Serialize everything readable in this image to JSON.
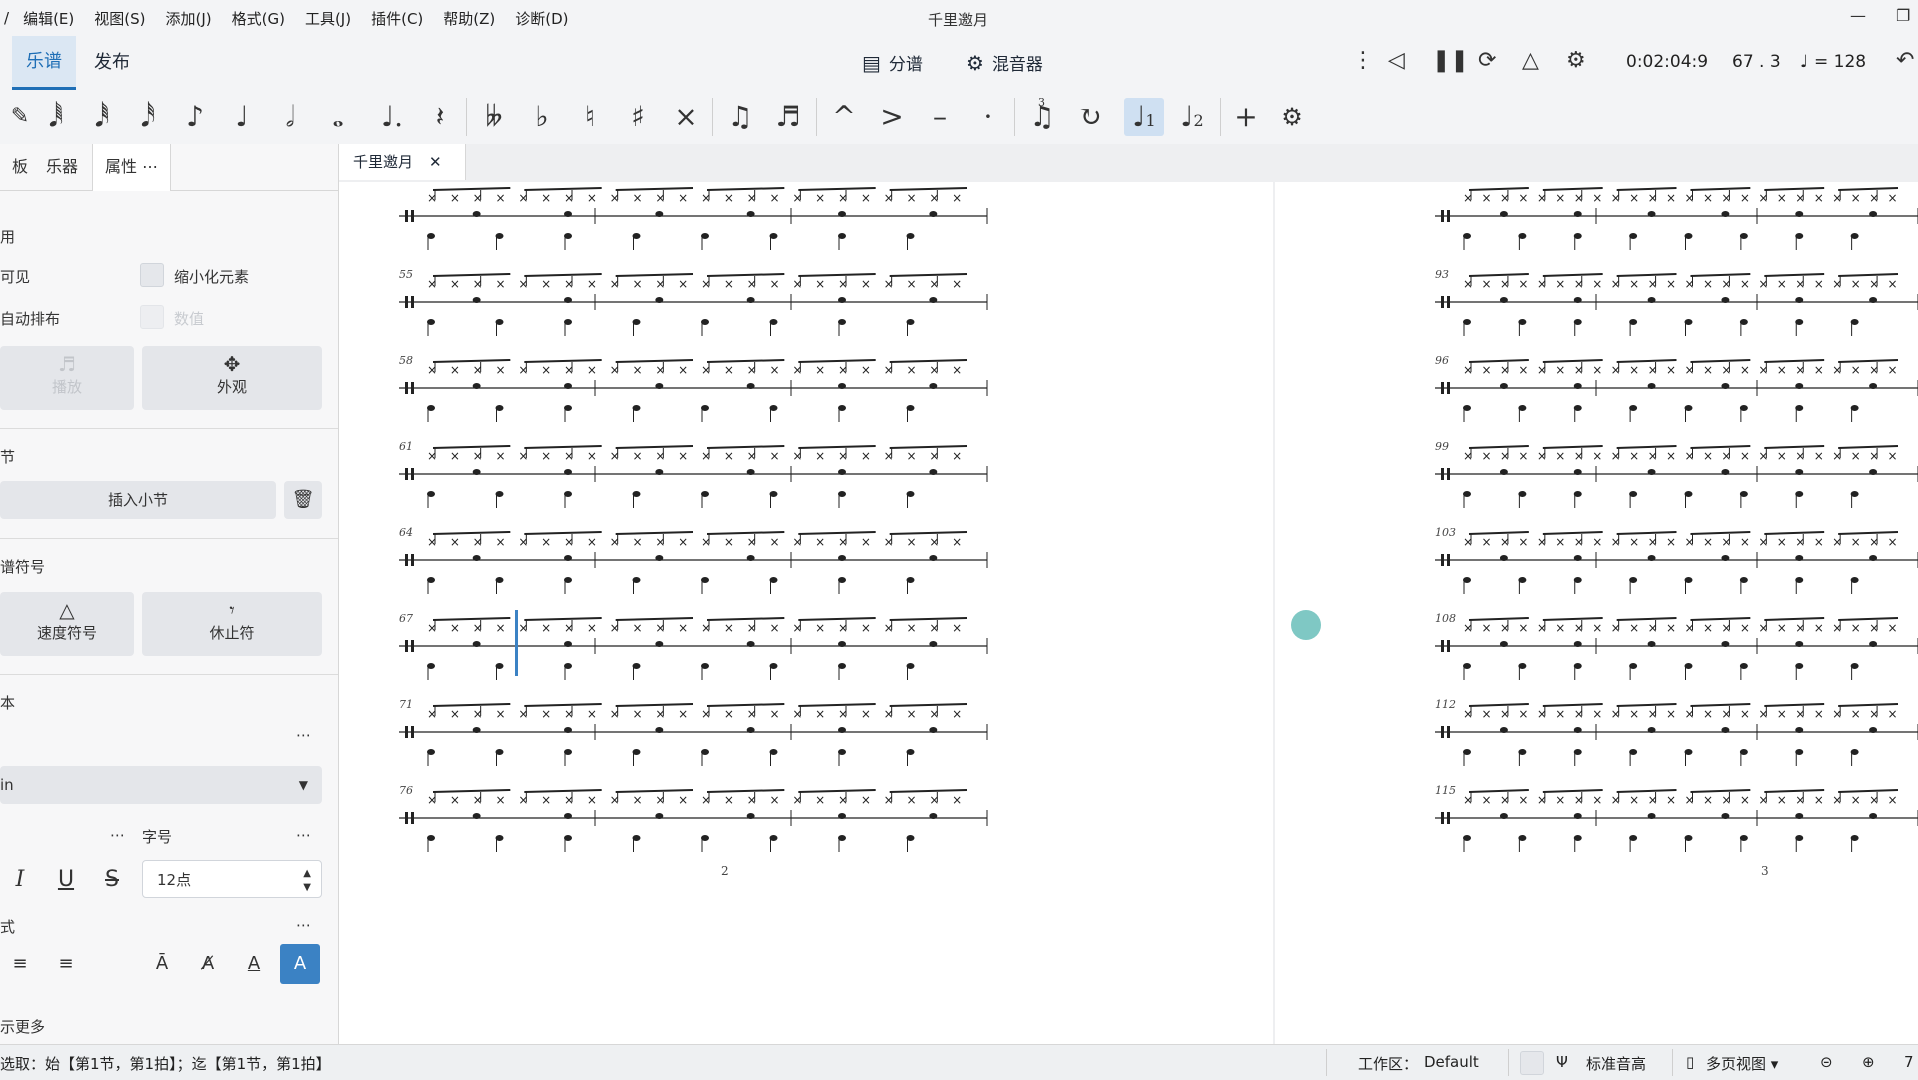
{
  "window": {
    "title": "千里邀月",
    "menu": [
      "编辑(E)",
      "视图(S)",
      "添加(J)",
      "格式(G)",
      "工具(J)",
      "插件(C)",
      "帮助(Z)",
      "诊断(D)"
    ],
    "menu_prefix": "/"
  },
  "tabs": {
    "score": "乐谱",
    "publish": "发布"
  },
  "toolbar": {
    "parts_label": "分谱",
    "mixer_label": "混音器",
    "time": "0:02:04:9",
    "measure_beat": "67 . 3",
    "tempo": "= 128"
  },
  "palette": {
    "icons": [
      "pen-icon",
      "note-64th-icon",
      "note-32nd-icon",
      "note-16th-icon",
      "note-eighth-icon",
      "note-quarter-icon",
      "note-half-icon",
      "note-whole-icon",
      "dot-icon",
      "rest-icon",
      "double-flat-icon",
      "flat-icon",
      "natural-icon",
      "sharp-icon",
      "double-sharp-icon",
      "tie-icon",
      "slur-icon",
      "marcato-icon",
      "accent-icon",
      "tenuto-icon",
      "staccato-icon",
      "tuplet-icon",
      "flip-icon",
      "voice1-icon",
      "voice2-icon",
      "add-icon",
      "settings-icon"
    ],
    "tuplet_number": "3"
  },
  "left_panel": {
    "tabs": [
      "板",
      "乐器",
      "属性"
    ],
    "section_general": "用",
    "visible_label": "可见",
    "scale_label": "缩小化元素",
    "auto_place_label": "自动排布",
    "auto_place_sub": "数值",
    "playback_btn": "播放",
    "appearance_btn": "外观",
    "measure_section": "节",
    "insert_measure": "插入小节",
    "symbols_section": "谱符号",
    "tempo_marking": "速度符号",
    "rest_btn": "休止符",
    "text_section": "本",
    "font_value": "in",
    "font_size_label": "字号",
    "font_size_value": "12点",
    "align_section": "式",
    "show_more": "示更多"
  },
  "score": {
    "doc_tab": "千里邀月",
    "left_page_measures": [
      "55",
      "58",
      "61",
      "64",
      "67",
      "71",
      "76"
    ],
    "right_page_measures": [
      "93",
      "96",
      "99",
      "103",
      "108",
      "112",
      "115"
    ],
    "page_numbers": [
      "2",
      "3"
    ]
  },
  "status": {
    "selection": "选取：始【第1节，第1拍】；迄【第1节，第1拍】",
    "workspace_label": "工作区：",
    "workspace_value": "Default",
    "concert_pitch": "标准音高",
    "view_mode": "多页视图",
    "zoom_suffix": "7"
  },
  "colors": {
    "accent": "#1f6fb6",
    "active_tab_bg": "#dbe7f3",
    "cursor": "#3b82c4"
  }
}
